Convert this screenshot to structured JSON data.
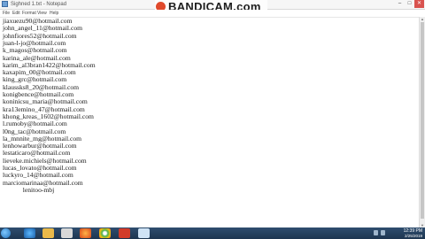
{
  "window": {
    "title": "Sighned 1.txt - Notepad"
  },
  "watermark": {
    "text": "BANDICAM.com"
  },
  "window_controls": {
    "minimize": "–",
    "maximize": "□",
    "close": "✕"
  },
  "menu": [
    "File",
    "Edit",
    "Format",
    "View",
    "Help"
  ],
  "lines": [
    "jiaxuezu90@hotmail.com",
    "john_angel_11@hotmail.com",
    "johnfiores52@hotmail.com",
    "juan-l-jo@hotmail.com",
    "k_magos@hotmail.com",
    "karina_ale@hotmail.com",
    "karim_al3bran1422@hotmail.com",
    "kaxapim_00@hotmail.com",
    "king_grc@hotmail.com",
    "klaussks8_20@hotmail.com",
    "konigbence@hotmail.com",
    "koninicsu_maria@hotmail.com",
    "kra13emino_47@hotmail.com",
    "khong_kreas_1602@hotmail.com",
    "l.rumoby@hotmail.com",
    "l0ng_tac@hotmail.com",
    "la_mnnite_mg@hotmail.com",
    "lenhowarbur@hotmail.com",
    "lestaticaro@hotmail.com",
    "lieveke.michiels@hotmail.com",
    "lucas_lovato@hotmail.com",
    "luckyro_14@hotmail.com",
    "marciomarinaa@hotmail.com",
    "            lenitoo-mbj"
  ],
  "taskbar": {
    "icons": [
      "windows-start-icon",
      "ie-icon",
      "explorer-icon",
      "media-icon",
      "firefox-icon",
      "chrome-icon",
      "bandicam-icon",
      "notepad-icon"
    ],
    "time": "12:39 PM",
    "date": "2/25/2019"
  },
  "colors": {
    "taskbar": "#1d3550",
    "watermark_mark": "#e04a2c"
  }
}
